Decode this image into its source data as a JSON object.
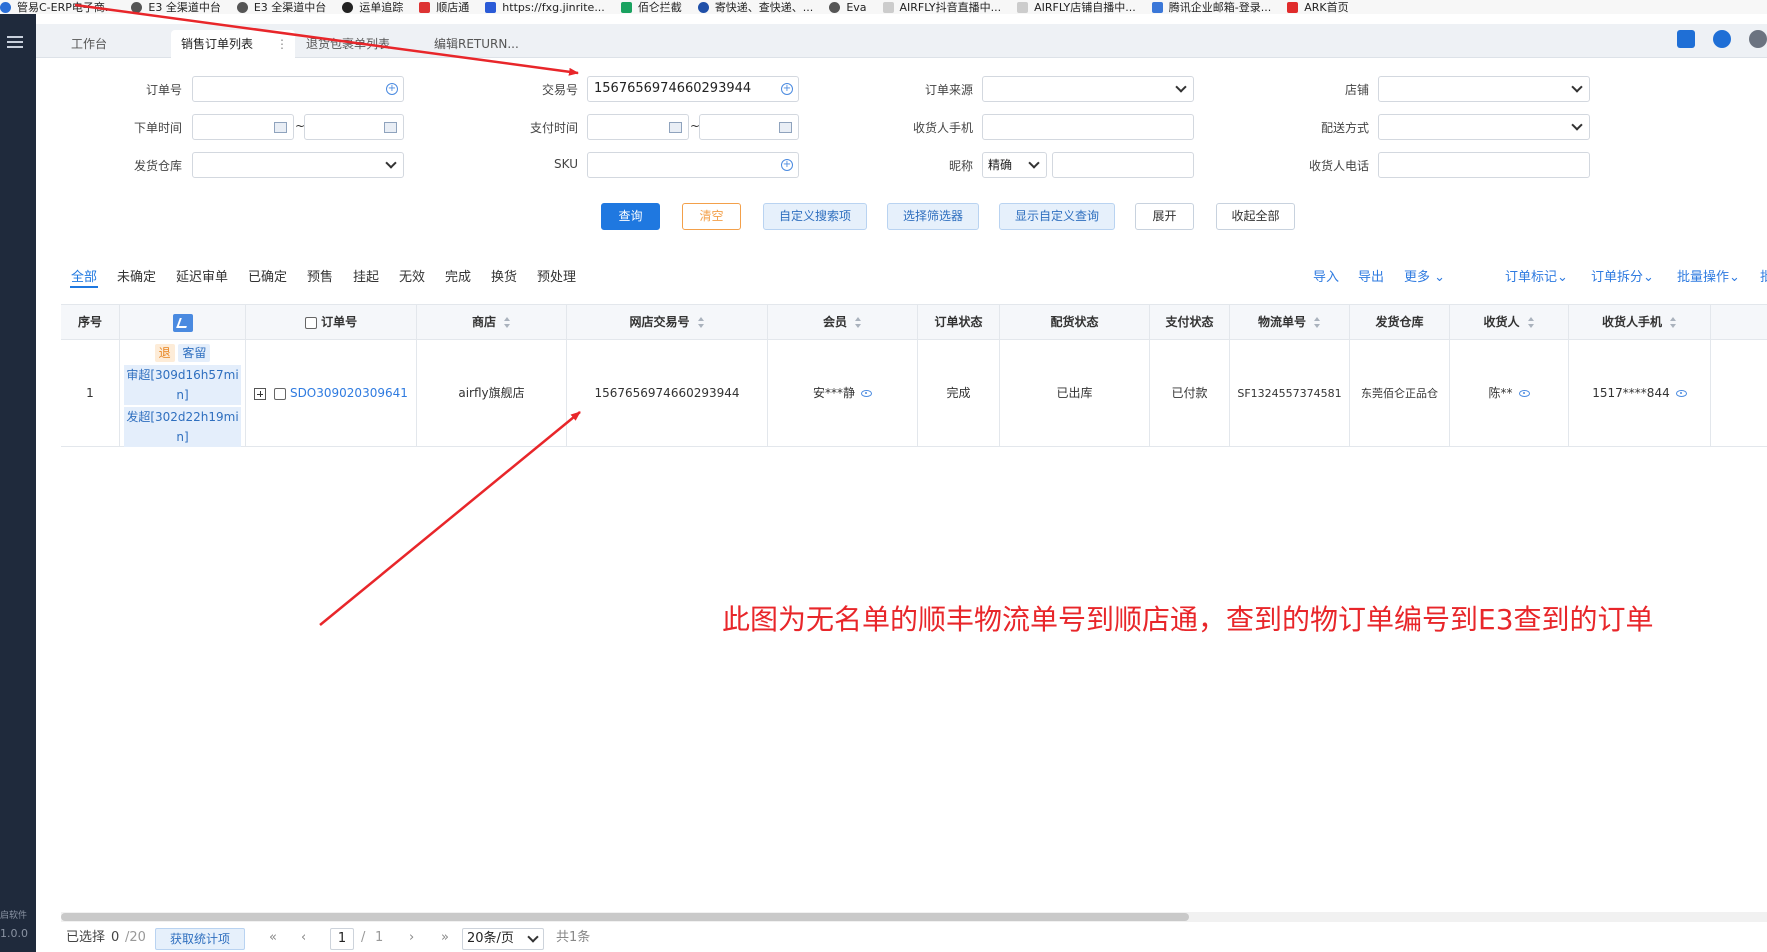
{
  "bookmarks": [
    {
      "label": "管易C-ERP电子商..."
    },
    {
      "label": "E3 全渠道中台"
    },
    {
      "label": "E3 全渠道中台"
    },
    {
      "label": "运单追踪"
    },
    {
      "label": "顺店通"
    },
    {
      "label": "https://fxg.jinrite..."
    },
    {
      "label": "佰仑拦截"
    },
    {
      "label": "寄快递、查快递、..."
    },
    {
      "label": "Eva"
    },
    {
      "label": "AIRFLY抖音直播中..."
    },
    {
      "label": "AIRFLY店铺自播中..."
    },
    {
      "label": "腾讯企业邮箱-登录..."
    },
    {
      "label": "ARK首页"
    }
  ],
  "nav": {
    "footer_text_1": "启软件",
    "footer_text_2": "1.0.0"
  },
  "tabs": [
    {
      "label": "工作台"
    },
    {
      "label": "销售订单列表"
    },
    {
      "label": "退货包裹单列表"
    },
    {
      "label": "编辑RETURN..."
    }
  ],
  "tab_dots": "⋮",
  "search": {
    "order_no": {
      "label": "订单号",
      "value": ""
    },
    "trade_no": {
      "label": "交易号",
      "value": "1567656974660293944"
    },
    "order_source": {
      "label": "订单来源",
      "value": ""
    },
    "shop": {
      "label": "店铺",
      "value": ""
    },
    "order_time": {
      "label": "下单时间",
      "value": ""
    },
    "pay_time": {
      "label": "支付时间",
      "value": ""
    },
    "receiver_mobile": {
      "label": "收货人手机",
      "value": ""
    },
    "delivery_method": {
      "label": "配送方式",
      "value": ""
    },
    "warehouse": {
      "label": "发货仓库",
      "value": ""
    },
    "sku": {
      "label": "SKU",
      "value": ""
    },
    "nickname": {
      "label": "昵称",
      "mode": "精确",
      "value": ""
    },
    "receiver_phone": {
      "label": "收货人电话",
      "value": ""
    },
    "tilde": "~"
  },
  "actions": {
    "query": "查询",
    "clear": "清空",
    "custom_search": "自定义搜索项",
    "select_filter": "选择筛选器",
    "show_custom_query": "显示自定义查询",
    "expand": "展开",
    "collapse_all": "收起全部"
  },
  "status_tabs": [
    "全部",
    "未确定",
    "延迟审单",
    "已确定",
    "预售",
    "挂起",
    "无效",
    "完成",
    "换货",
    "预处理"
  ],
  "ops": {
    "import": "导入",
    "export": "导出",
    "more": "更多",
    "order_mark": "订单标记",
    "order_split": "订单拆分",
    "batch_ops": "批量操作",
    "more_cut": "批"
  },
  "table": {
    "headers": {
      "seq": "序号",
      "order_no": "订单号",
      "shop": "商店",
      "online_trade_no": "网店交易号",
      "member": "会员",
      "order_status": "订单状态",
      "delivery_status": "配货状态",
      "pay_status": "支付状态",
      "logistics_no": "物流单号",
      "warehouse": "发货仓库",
      "receiver": "收货人",
      "receiver_mobile": "收货人手机"
    },
    "rows": [
      {
        "seq": "1",
        "tag_refund": "退",
        "tag_hold": "客留",
        "audit_overdue_1": "审超[309d16h57mi",
        "audit_overdue_2": "n]",
        "ship_overdue_1": "发超[302d22h19mi",
        "ship_overdue_2": "n]",
        "order_no": "SDO309020309641",
        "shop": "airfly旗舰店",
        "online_trade_no": "1567656974660293944",
        "member": "安***静",
        "order_status": "完成",
        "delivery_status": "已出库",
        "pay_status": "已付款",
        "logistics_no": "SF1324557374581",
        "warehouse": "东莞佰仑正品仓",
        "receiver": "陈**",
        "receiver_mobile": "1517****844"
      }
    ]
  },
  "footer": {
    "selected_label": "已选择",
    "selected_count": "0",
    "selected_total": "/20",
    "stats_button": "获取统计项",
    "page_current": "1",
    "page_sep": "/",
    "page_total": "1",
    "page_size": "20条/页",
    "total_text": "共1条"
  },
  "annotation": {
    "text": "此图为无名单的顺丰物流单号到顺店通，查到的物订单编号到E3查到的订单",
    "color": "#e8262a"
  },
  "colors": {
    "primary": "#1f78e0",
    "nav_bg": "#1f2a3c",
    "warn": "#f3a04a"
  }
}
